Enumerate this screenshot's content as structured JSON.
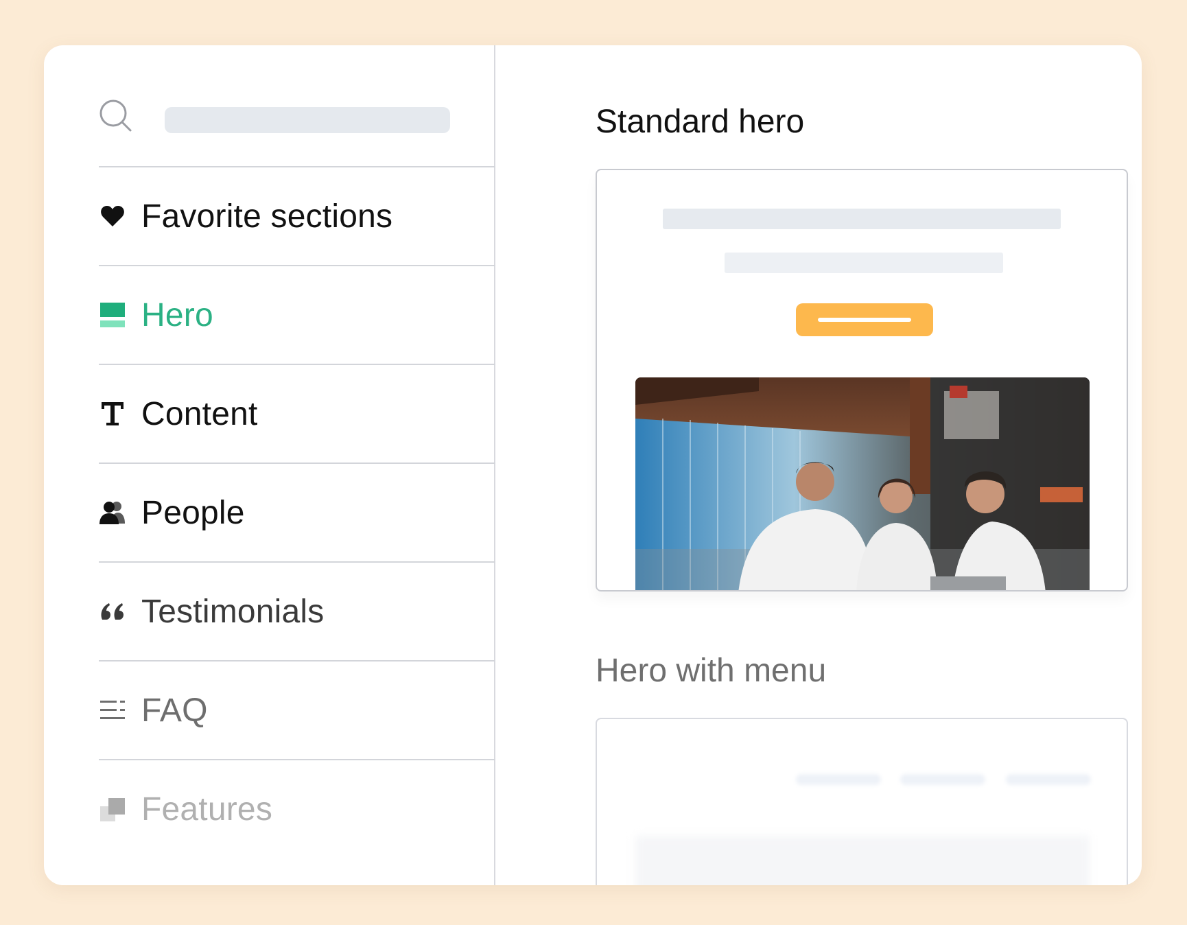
{
  "sidebar": {
    "search": {
      "placeholder": ""
    },
    "items": [
      {
        "label": "Favorite sections",
        "icon": "heart-icon",
        "state": "normal"
      },
      {
        "label": "Hero",
        "icon": "hero-section-icon",
        "state": "active"
      },
      {
        "label": "Content",
        "icon": "text-icon",
        "state": "normal"
      },
      {
        "label": "People",
        "icon": "people-icon",
        "state": "normal"
      },
      {
        "label": "Testimonials",
        "icon": "quote-icon",
        "state": "normal"
      },
      {
        "label": "FAQ",
        "icon": "list-icon",
        "state": "normal"
      },
      {
        "label": "Features",
        "icon": "features-icon",
        "state": "normal"
      }
    ]
  },
  "main": {
    "sections": [
      {
        "title": "Standard hero"
      },
      {
        "title": "Hero with menu"
      }
    ]
  },
  "colors": {
    "background": "#fcebd5",
    "accent": "#2bb184",
    "cta": "#fdb84d",
    "placeholder": "#e5e9ee"
  }
}
